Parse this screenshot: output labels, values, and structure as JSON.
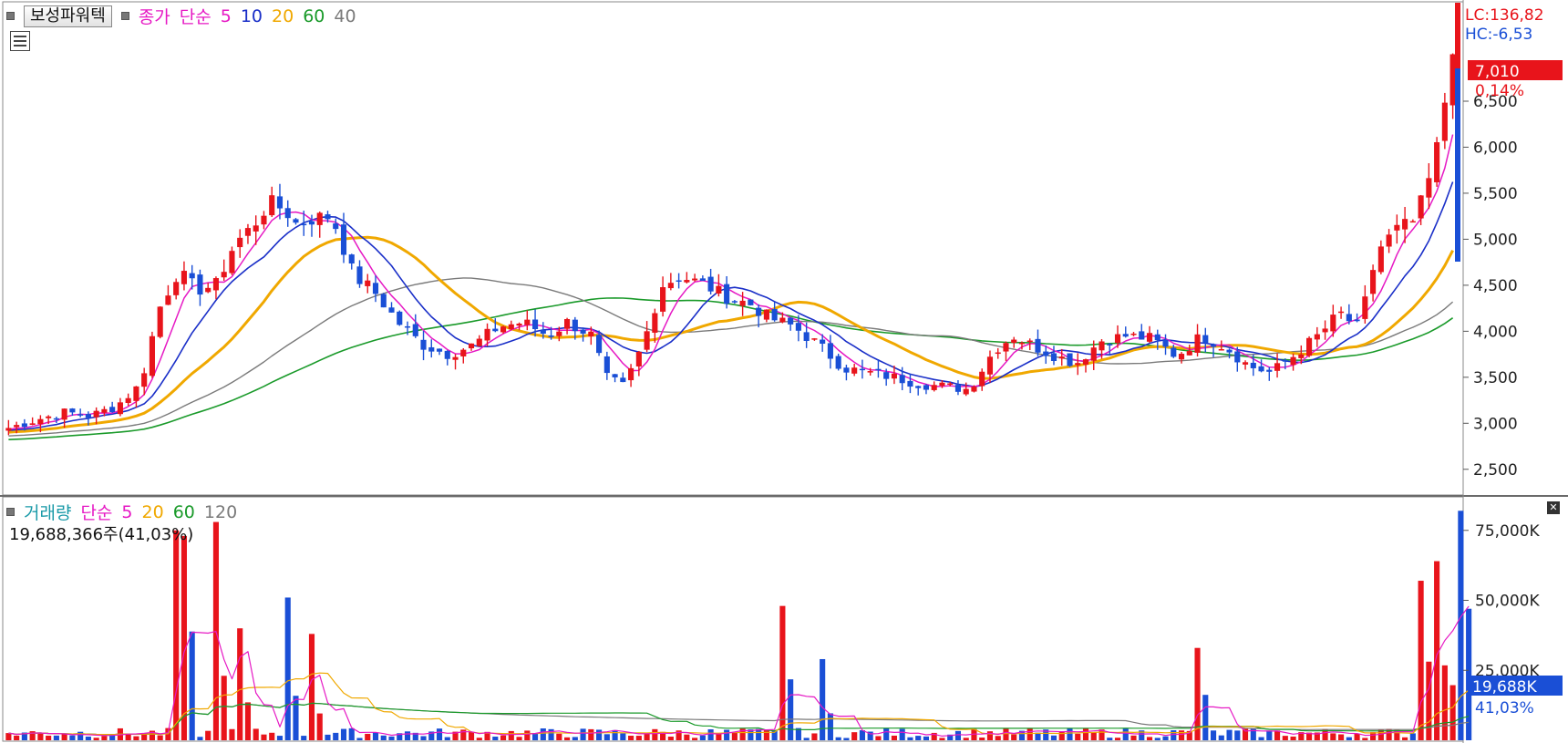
{
  "price_panel": {
    "stock_name": "보성파워텍",
    "legend_close": "종가",
    "legend_method": "단순",
    "ma_periods": [
      "5",
      "10",
      "20",
      "60",
      "40"
    ],
    "lc_label": "LC:136,82",
    "hc_label": "HC:-6,53",
    "current_price": "7,010",
    "current_change": "0,14%",
    "price_ticks": [
      "6,500",
      "6,000",
      "5,500",
      "5,000",
      "4,500",
      "4,000",
      "3,500",
      "3,000",
      "2,500"
    ]
  },
  "volume_panel": {
    "title": "거래량",
    "legend_method": "단순",
    "ma_periods": [
      "5",
      "20",
      "60",
      "120"
    ],
    "volume_info": "19,688,366주(41,03%)",
    "current_volume": "19,688K",
    "current_ratio": "41,03%",
    "volume_ticks": [
      "75,000K",
      "50,000K",
      "25,000K"
    ],
    "close_icon": "close-icon"
  },
  "colors": {
    "up": "#e8141b",
    "down": "#1a4fd6",
    "ma5": "#e619c4",
    "ma10": "#1a2fc8",
    "ma20": "#f0a800",
    "ma60": "#1a9a2a",
    "ma40": "#7a7a7a"
  },
  "chart_data": [
    {
      "type": "candlestick",
      "price_ticks": [
        6500,
        6000,
        5500,
        5000,
        4500,
        4000,
        3500,
        3000,
        2500
      ],
      "ylim": [
        2250,
        7550
      ],
      "bar_count": 182,
      "close_path": [
        [
          0,
          2950
        ],
        [
          10,
          3050
        ],
        [
          18,
          3120
        ],
        [
          26,
          3080
        ],
        [
          34,
          3180
        ],
        [
          42,
          3420
        ],
        [
          48,
          4250
        ],
        [
          54,
          4650
        ],
        [
          60,
          4450
        ],
        [
          66,
          4500
        ],
        [
          72,
          4950
        ],
        [
          78,
          5150
        ],
        [
          83,
          5400
        ],
        [
          88,
          5320
        ],
        [
          92,
          5150
        ],
        [
          97,
          5230
        ],
        [
          103,
          5250
        ],
        [
          110,
          4600
        ],
        [
          116,
          4450
        ],
        [
          124,
          4100
        ],
        [
          132,
          3850
        ],
        [
          140,
          3750
        ],
        [
          148,
          3850
        ],
        [
          156,
          4050
        ],
        [
          164,
          4100
        ],
        [
          172,
          3950
        ],
        [
          178,
          4100
        ],
        [
          186,
          3950
        ],
        [
          190,
          3500
        ],
        [
          196,
          3400
        ],
        [
          202,
          3850
        ],
        [
          208,
          4500
        ],
        [
          214,
          4600
        ],
        [
          222,
          4500
        ],
        [
          230,
          4350
        ],
        [
          236,
          4300
        ],
        [
          242,
          4150
        ],
        [
          250,
          4050
        ],
        [
          258,
          3850
        ],
        [
          266,
          3600
        ],
        [
          274,
          3550
        ],
        [
          282,
          3500
        ],
        [
          290,
          3430
        ],
        [
          298,
          3400
        ],
        [
          306,
          3370
        ],
        [
          314,
          3800
        ],
        [
          320,
          3950
        ],
        [
          330,
          3780
        ],
        [
          340,
          3650
        ],
        [
          348,
          3900
        ],
        [
          356,
          3950
        ],
        [
          364,
          3920
        ],
        [
          372,
          3730
        ],
        [
          380,
          3950
        ],
        [
          388,
          3820
        ],
        [
          395,
          3620
        ],
        [
          402,
          3550
        ],
        [
          410,
          3750
        ],
        [
          418,
          3980
        ],
        [
          424,
          4200
        ],
        [
          430,
          4030
        ],
        [
          436,
          4880
        ],
        [
          442,
          5100
        ],
        [
          448,
          5200
        ],
        [
          454,
          5800
        ],
        [
          460,
          7010
        ]
      ],
      "ma_values_at_last_bar": {
        "5": 6400,
        "10": 5700,
        "20": 4750,
        "60": 4000,
        "40": 4300
      },
      "lc": 136.82,
      "hc": -6.53,
      "last_close": 7010,
      "last_change_pct": 0.14
    },
    {
      "type": "bar",
      "name": "거래량",
      "volume_ticks": [
        75000,
        50000,
        25000
      ],
      "ylim": [
        0,
        86000
      ],
      "unit": "K",
      "spikes": [
        [
          54,
          75000
        ],
        [
          57,
          73000
        ],
        [
          67,
          78000
        ],
        [
          74,
          40000
        ],
        [
          88,
          51000
        ],
        [
          96,
          38000
        ],
        [
          246,
          48000
        ],
        [
          258,
          29000
        ],
        [
          378,
          33000
        ],
        [
          450,
          57000
        ],
        [
          454,
          64000
        ],
        [
          460,
          67000
        ],
        [
          462,
          82000
        ],
        [
          464,
          47000
        ]
      ],
      "baseline": 2000,
      "last_volume": 19688,
      "last_ratio_pct": 41.03
    }
  ]
}
